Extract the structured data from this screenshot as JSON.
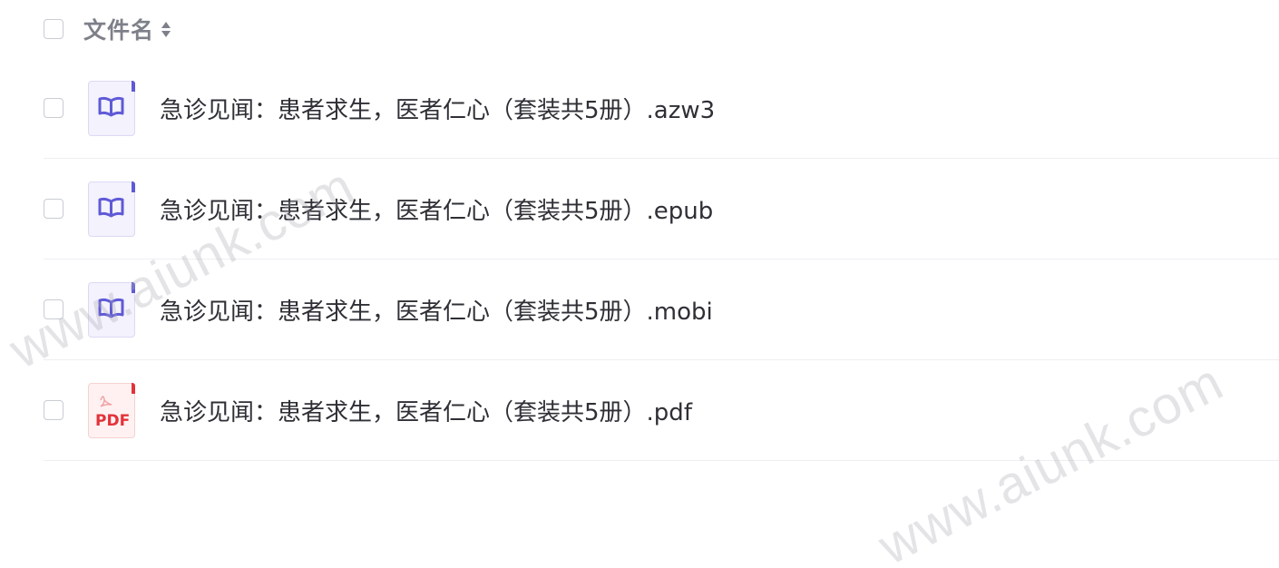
{
  "header": {
    "column_label": "文件名"
  },
  "files": [
    {
      "name": "急诊见闻：患者求生，医者仁心（套装共5册）.azw3",
      "type": "ebook-icon"
    },
    {
      "name": "急诊见闻：患者求生，医者仁心（套装共5册）.epub",
      "type": "ebook-icon"
    },
    {
      "name": "急诊见闻：患者求生，医者仁心（套装共5册）.mobi",
      "type": "ebook-icon"
    },
    {
      "name": "急诊见闻：患者求生，医者仁心（套装共5册）.pdf",
      "type": "pdf-icon",
      "icon_text": "PDF"
    }
  ],
  "watermark": {
    "text": "www.aiunk.com"
  },
  "colors": {
    "ebook_accent": "#5f5ad6",
    "pdf_accent": "#e3323a",
    "text": "#2f3036",
    "header_text": "#7e8089"
  }
}
